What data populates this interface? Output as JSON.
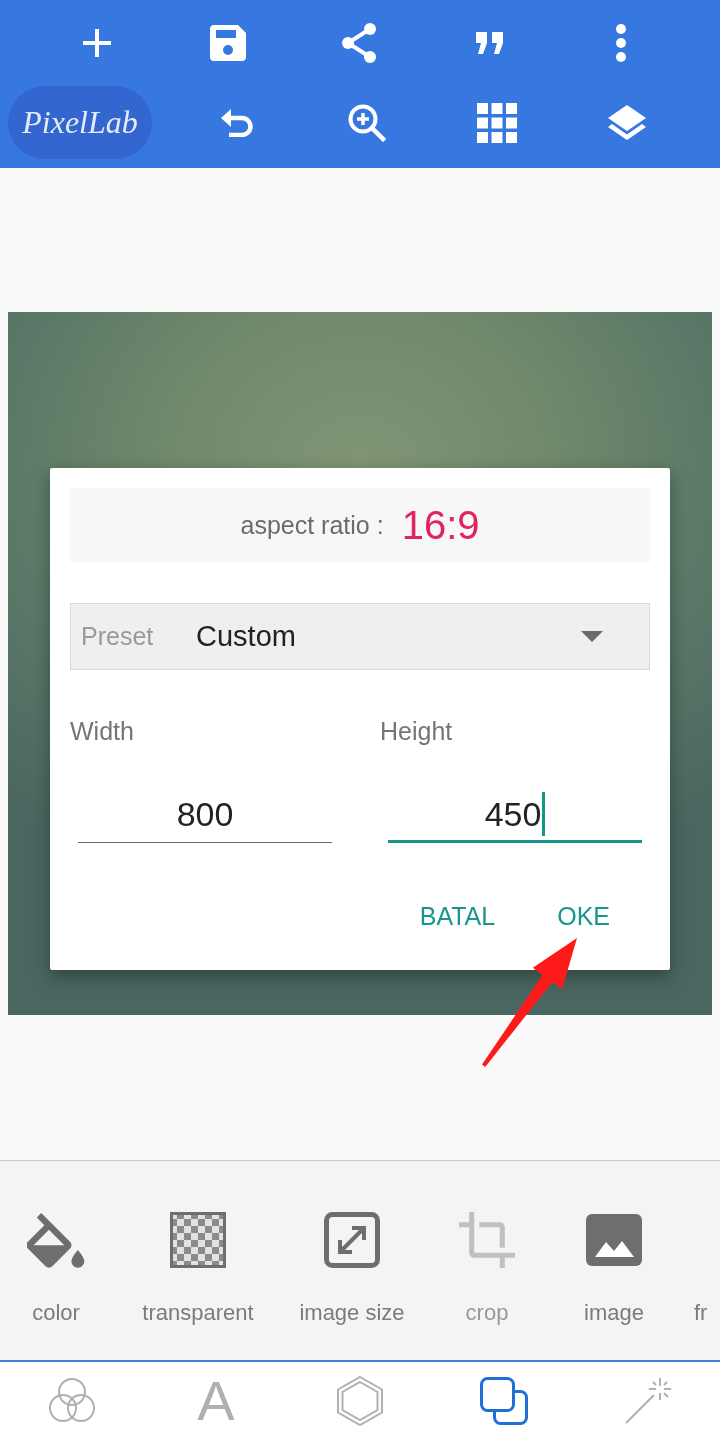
{
  "app_bar": {
    "logo": "PixelLab"
  },
  "dialog": {
    "aspect_ratio": {
      "label": "aspect ratio :",
      "value": "16:9"
    },
    "preset": {
      "label": "Preset",
      "value": "Custom"
    },
    "fields": [
      {
        "label": "Width",
        "value": "800",
        "focused": false
      },
      {
        "label": "Height",
        "value": "450",
        "focused": true
      }
    ],
    "buttons": [
      "BATAL",
      "OKE"
    ]
  },
  "tools": [
    {
      "label": "color",
      "disabled": false
    },
    {
      "label": "transparent",
      "disabled": false
    },
    {
      "label": "image size",
      "disabled": false
    },
    {
      "label": "crop",
      "disabled": true
    },
    {
      "label": "image",
      "disabled": false
    },
    {
      "label": "fr",
      "disabled": false
    }
  ],
  "nav_tabs": [
    {
      "selected": false
    },
    {
      "label": "A",
      "selected": false
    },
    {
      "selected": false
    },
    {
      "selected": true
    },
    {
      "selected": false
    }
  ]
}
